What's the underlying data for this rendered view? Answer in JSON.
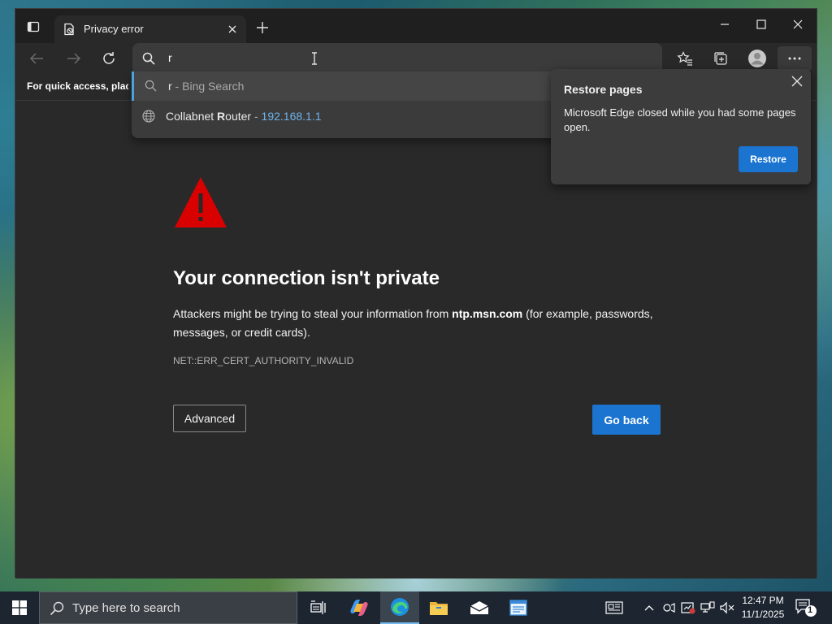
{
  "browser": {
    "tab": {
      "title": "Privacy error"
    },
    "omnibox": {
      "value": "r"
    },
    "favorites_bar": {
      "text": "For quick access, place y"
    },
    "suggestions": [
      {
        "query": "r",
        "separator": " - ",
        "source": "Bing Search"
      },
      {
        "name_prefix": "Collabnet ",
        "name_match": "R",
        "name_rest": "outer",
        "separator": " - ",
        "url": "192.168.1.1"
      }
    ]
  },
  "error_page": {
    "title": "Your connection isn't private",
    "desc_before": "Attackers might be trying to steal your information from ",
    "domain": "ntp.msn.com",
    "desc_after": " (for example, passwords, messages, or credit cards).",
    "error_code": "NET::ERR_CERT_AUTHORITY_INVALID",
    "advanced_label": "Advanced",
    "go_back_label": "Go back"
  },
  "restore_popup": {
    "title": "Restore pages",
    "message": "Microsoft Edge closed while you had some pages open.",
    "button_label": "Restore"
  },
  "taskbar": {
    "search_placeholder": "Type here to search",
    "time": "12:47 PM",
    "date": "11/1/2025",
    "notification_count": "1"
  },
  "colors": {
    "accent": "#1a74d0",
    "warning": "#d90000",
    "link": "#6fb3ea"
  }
}
